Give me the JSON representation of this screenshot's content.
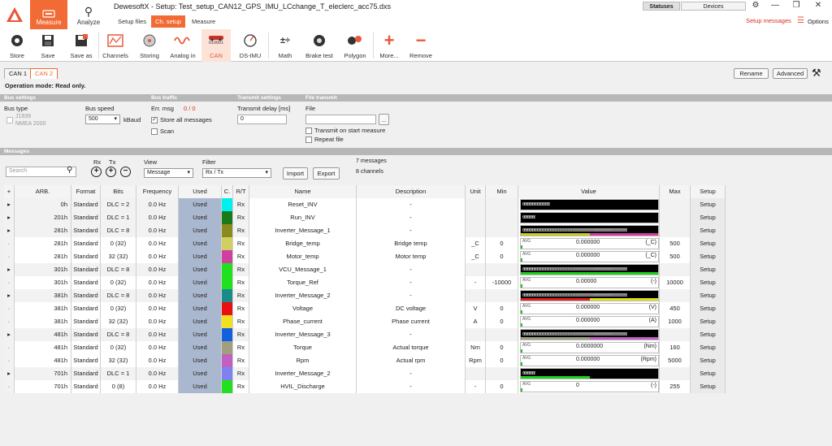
{
  "app": {
    "title": "DewesoftX - Setup: Test_setup_CAN12_GPS_IMU_LCchange_T_eleclerc_acc75.dxs"
  },
  "main_tabs": [
    {
      "label": "Measure"
    },
    {
      "label": "Analyze"
    }
  ],
  "sub_tabs": [
    {
      "label": "Setup files"
    },
    {
      "label": "Ch. setup"
    },
    {
      "label": "Measure"
    }
  ],
  "top_right": {
    "statuses": "Statuses",
    "devices": "Devices",
    "setup_messages": "Setup messages",
    "options": "Options"
  },
  "toolbar": [
    {
      "label": "Store",
      "icon": "record-icon"
    },
    {
      "label": "Save",
      "icon": "save-icon"
    },
    {
      "label": "Save as",
      "icon": "save-as-icon"
    },
    {
      "label": "Channels",
      "icon": "channels-icon"
    },
    {
      "label": "Storing",
      "icon": "storing-icon"
    },
    {
      "label": "Analog in",
      "icon": "analog-in-icon"
    },
    {
      "label": "CAN",
      "icon": "can-icon",
      "sub": "010001"
    },
    {
      "label": "DS-IMU",
      "icon": "imu-icon"
    },
    {
      "label": "Math",
      "icon": "math-icon"
    },
    {
      "label": "Brake test",
      "icon": "brake-test-icon"
    },
    {
      "label": "Polygon",
      "icon": "polygon-icon"
    },
    {
      "label": "More...",
      "icon": "plus-icon"
    },
    {
      "label": "Remove",
      "icon": "minus-icon"
    }
  ],
  "can_tabs": [
    {
      "label": "CAN 1"
    },
    {
      "label": "CAN 2"
    }
  ],
  "right_buttons": {
    "rename": "Rename",
    "advanced": "Advanced"
  },
  "operation_mode": "Operation mode: Read only.",
  "sections": {
    "bus_settings": "Bus settings",
    "bus_traffic": "Bus traffic",
    "transmit_settings": "Transmit settings",
    "file_transmit": "File transmit",
    "messages": "Messages"
  },
  "bus": {
    "bus_type_label": "Bus type",
    "j1939": "J1939",
    "nmea": "NMEA 2000",
    "bus_speed_label": "Bus speed",
    "bus_speed_value": "500",
    "kbaud": "kBaud",
    "err_msg_label": "Err. msg",
    "err_msg_value": "0 / 0",
    "store_all": "Store all messages",
    "scan": "Scan",
    "transmit_delay_label": "Transmit delay [ms]",
    "transmit_delay_value": "0",
    "file_label": "File",
    "browse": "...",
    "transmit_on_start": "Transmit on start measure",
    "repeat_file": "Repeat file"
  },
  "messages_controls": {
    "search_placeholder": "Search",
    "rx": "Rx",
    "tx": "Tx",
    "view_label": "View",
    "view_value": "Message",
    "filter_label": "Filter",
    "filter_value": "Rx / Tx",
    "import": "Import",
    "export": "Export",
    "msg_count": "7 messages",
    "ch_count": "8 channels"
  },
  "table": {
    "headers": [
      "+",
      "ARB.",
      "Format",
      "Bits",
      "Frequency",
      "Used",
      "C.",
      "R/T",
      "Name",
      "Description",
      "Unit",
      "Min",
      "Value",
      "Max",
      "Setup"
    ],
    "rows": [
      {
        "exp": "▸",
        "arb": "0h",
        "fmt": "Standard",
        "bits": "DLC = 2",
        "freq": "0.0 Hz",
        "used": "Used",
        "color": "#00f0f0",
        "rt": "Rx",
        "name": "Reset_INV",
        "desc": "-",
        "unit": "",
        "min": "",
        "kind": "msg",
        "vbits": "00000000000000000",
        "max": "",
        "setup": "Setup",
        "indent": false
      },
      {
        "exp": "▸",
        "arb": "201h",
        "fmt": "Standard",
        "bits": "DLC = 1",
        "freq": "0.0 Hz",
        "used": "Used",
        "color": "#1a7a1a",
        "rt": "Rx",
        "name": "Run_INV",
        "desc": "-",
        "unit": "",
        "min": "",
        "kind": "msg",
        "vbits": "00000000",
        "max": "",
        "setup": "Setup",
        "indent": false
      },
      {
        "exp": "▸",
        "arb": "281h",
        "fmt": "Standard",
        "bits": "DLC = 8",
        "freq": "0.0 Hz",
        "used": "Used",
        "color": "#8a8a20",
        "rt": "Rx",
        "name": "Inverter_Message_1",
        "desc": "-",
        "unit": "",
        "min": "",
        "kind": "msg",
        "vbits": "0000000000000000000000000000000000000000000000000000000000000000",
        "max": "",
        "setup": "Setup",
        "indent": false,
        "bar1": "#c8c820",
        "bar2": "#d040a0"
      },
      {
        "exp": "·",
        "arb": "281h",
        "fmt": "Standard",
        "bits": "0 (32)",
        "freq": "0.0 Hz",
        "used": "Used",
        "color": "#d0d060",
        "rt": "Rx",
        "name": "Bridge_temp",
        "desc": "Bridge temp",
        "unit": "_C",
        "min": "0",
        "kind": "ch",
        "avg": "AVG",
        "val": "0.000000",
        "vunit": "(_C)",
        "max": "500",
        "setup": "Setup",
        "indent": true
      },
      {
        "exp": "·",
        "arb": "281h",
        "fmt": "Standard",
        "bits": "32 (32)",
        "freq": "0.0 Hz",
        "used": "Used",
        "color": "#d040a0",
        "rt": "Rx",
        "name": "Motor_temp",
        "desc": "Motor temp",
        "unit": "_C",
        "min": "0",
        "kind": "ch",
        "avg": "AVG",
        "val": "0.000000",
        "vunit": "(_C)",
        "max": "500",
        "setup": "Setup",
        "indent": true
      },
      {
        "exp": "▸",
        "arb": "301h",
        "fmt": "Standard",
        "bits": "DLC = 8",
        "freq": "0.0 Hz",
        "used": "Used",
        "color": "#20e020",
        "rt": "Rx",
        "name": "VCU_Message_1",
        "desc": "-",
        "unit": "",
        "min": "",
        "kind": "msg",
        "vbits": "0000000000000000000000000000000000000000000000000000000000000000",
        "max": "",
        "setup": "Setup",
        "indent": false,
        "bar1": "#20d020",
        "bar2": "#20d020"
      },
      {
        "exp": "·",
        "arb": "301h",
        "fmt": "Standard",
        "bits": "0 (32)",
        "freq": "0.0 Hz",
        "used": "Used",
        "color": "#20e020",
        "rt": "Rx",
        "name": "Torque_Ref",
        "desc": "-",
        "unit": "-",
        "min": "-10000",
        "kind": "ch",
        "avg": "AVG",
        "val": "0.00000",
        "vunit": "(-)",
        "max": "10000",
        "setup": "Setup",
        "indent": true
      },
      {
        "exp": "▸",
        "arb": "381h",
        "fmt": "Standard",
        "bits": "DLC = 8",
        "freq": "0.0 Hz",
        "used": "Used",
        "color": "#1a8a8a",
        "rt": "Rx",
        "name": "Inverter_Message_2",
        "desc": "-",
        "unit": "",
        "min": "",
        "kind": "msg",
        "vbits": "0000000000000000000000000000000000000000000000000000000000000000",
        "max": "",
        "setup": "Setup",
        "indent": false,
        "bar1": "#e02020",
        "bar2": "#e0e020"
      },
      {
        "exp": "·",
        "arb": "381h",
        "fmt": "Standard",
        "bits": "0 (32)",
        "freq": "0.0 Hz",
        "used": "Used",
        "color": "#e81010",
        "rt": "Rx",
        "name": "Voltage",
        "desc": "DC voltage",
        "unit": "V",
        "min": "0",
        "kind": "ch",
        "avg": "AVG",
        "val": "0.000000",
        "vunit": "(V)",
        "max": "450",
        "setup": "Setup",
        "indent": true
      },
      {
        "exp": "·",
        "arb": "381h",
        "fmt": "Standard",
        "bits": "32 (32)",
        "freq": "0.0 Hz",
        "used": "Used",
        "color": "#f0e020",
        "rt": "Rx",
        "name": "Phase_current",
        "desc": "Phase current",
        "unit": "A",
        "min": "0",
        "kind": "ch",
        "avg": "AVG",
        "val": "0.000000",
        "vunit": "(A)",
        "max": "1000",
        "setup": "Setup",
        "indent": true
      },
      {
        "exp": "▸",
        "arb": "481h",
        "fmt": "Standard",
        "bits": "DLC = 8",
        "freq": "0.0 Hz",
        "used": "Used",
        "color": "#1060e0",
        "rt": "Rx",
        "name": "Inverter_Message_3",
        "desc": "-",
        "unit": "",
        "min": "",
        "kind": "msg",
        "vbits": "0000000000000000000000000000000000000000000000000000000000000000",
        "max": "",
        "setup": "Setup",
        "indent": false,
        "bar1": "#a0a080",
        "bar2": "#c060c0"
      },
      {
        "exp": "·",
        "arb": "481h",
        "fmt": "Standard",
        "bits": "0 (32)",
        "freq": "0.0 Hz",
        "used": "Used",
        "color": "#a0a080",
        "rt": "Rx",
        "name": "Torque",
        "desc": "Actual torque",
        "unit": "Nm",
        "min": "0",
        "kind": "ch",
        "avg": "AVG",
        "val": "0.0000000",
        "vunit": "(Nm)",
        "max": "160",
        "setup": "Setup",
        "indent": true
      },
      {
        "exp": "·",
        "arb": "481h",
        "fmt": "Standard",
        "bits": "32 (32)",
        "freq": "0.0 Hz",
        "used": "Used",
        "color": "#c060c0",
        "rt": "Rx",
        "name": "Rpm",
        "desc": "Actual rpm",
        "unit": "Rpm",
        "min": "0",
        "kind": "ch",
        "avg": "AVG",
        "val": "0.000000",
        "vunit": "(Rpm)",
        "max": "5000",
        "setup": "Setup",
        "indent": true
      },
      {
        "exp": "▸",
        "arb": "701h",
        "fmt": "Standard",
        "bits": "DLC = 1",
        "freq": "0.0 Hz",
        "used": "Used",
        "color": "#8080f0",
        "rt": "Rx",
        "name": "Inverter_Message_2",
        "desc": "-",
        "unit": "",
        "min": "",
        "kind": "msg",
        "vbits": "00000000",
        "max": "",
        "setup": "Setup",
        "indent": false,
        "bar1": "#20d020",
        "bar2": "#000000"
      },
      {
        "exp": "·",
        "arb": "701h",
        "fmt": "Standard",
        "bits": "0 (8)",
        "freq": "0.0 Hz",
        "used": "Used",
        "color": "#20e020",
        "rt": "Rx",
        "name": "HVIL_Discharge",
        "desc": "-",
        "unit": "-",
        "min": "0",
        "kind": "ch",
        "avg": "AVG",
        "val": "0",
        "vunit": "(-)",
        "max": "255",
        "setup": "Setup",
        "indent": true
      }
    ]
  }
}
